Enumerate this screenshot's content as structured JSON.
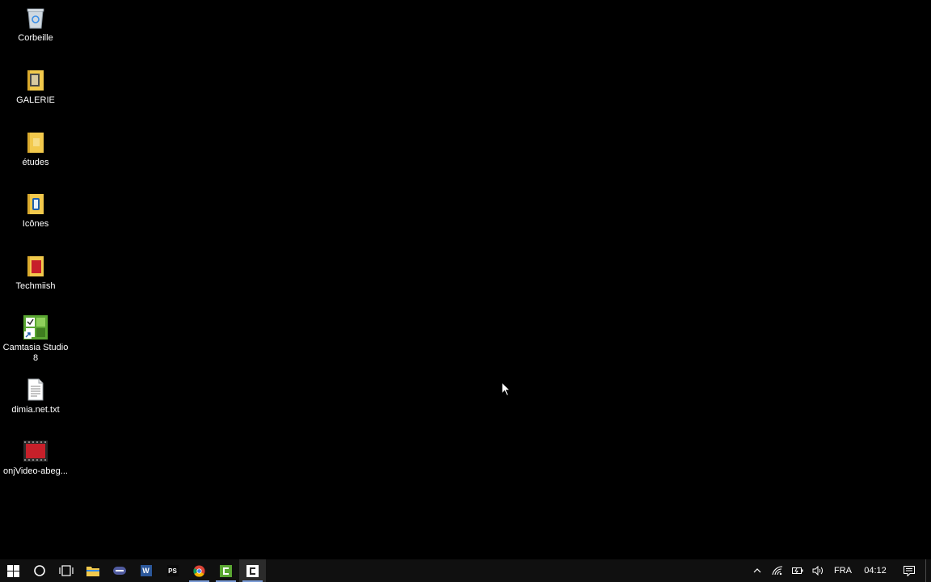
{
  "desktop": {
    "icons": [
      {
        "label": "Corbeille",
        "icon": "recycle-bin-icon"
      },
      {
        "label": "GALERIE",
        "icon": "folder-icon"
      },
      {
        "label": "études",
        "icon": "folder-icon"
      },
      {
        "label": "Icônes",
        "icon": "folder-icon"
      },
      {
        "label": "Techmiish",
        "icon": "folder-icon"
      },
      {
        "label": "Camtasia Studio 8",
        "icon": "camtasia-shortcut-icon"
      },
      {
        "label": "dimia.net.txt",
        "icon": "text-file-icon"
      },
      {
        "label": "onjVideo-abeg...",
        "icon": "video-file-icon"
      }
    ]
  },
  "taskbar": {
    "apps": [
      {
        "name": "start-button",
        "icon": "windows-logo-icon"
      },
      {
        "name": "cortana-search-button",
        "icon": "circle-icon"
      },
      {
        "name": "task-view-button",
        "icon": "task-view-icon"
      },
      {
        "name": "file-explorer-button",
        "icon": "folder-icon"
      },
      {
        "name": "app-button",
        "icon": "pill-icon"
      },
      {
        "name": "word-button",
        "icon": "word-icon"
      },
      {
        "name": "photoshop-button",
        "icon": "ps-icon"
      },
      {
        "name": "chrome-button",
        "icon": "chrome-icon"
      },
      {
        "name": "camtasia-button",
        "icon": "camtasia-icon"
      },
      {
        "name": "camtasia-recorder-button",
        "icon": "camtasia-icon"
      }
    ],
    "ps_label": "PS",
    "word_label": "W",
    "tray": {
      "language": "FRA",
      "time": "04:12"
    }
  },
  "colors": {
    "background": "#000000",
    "taskbar": "#101010",
    "folder": "#f2c94c",
    "camtasia_green": "#5aa632"
  }
}
